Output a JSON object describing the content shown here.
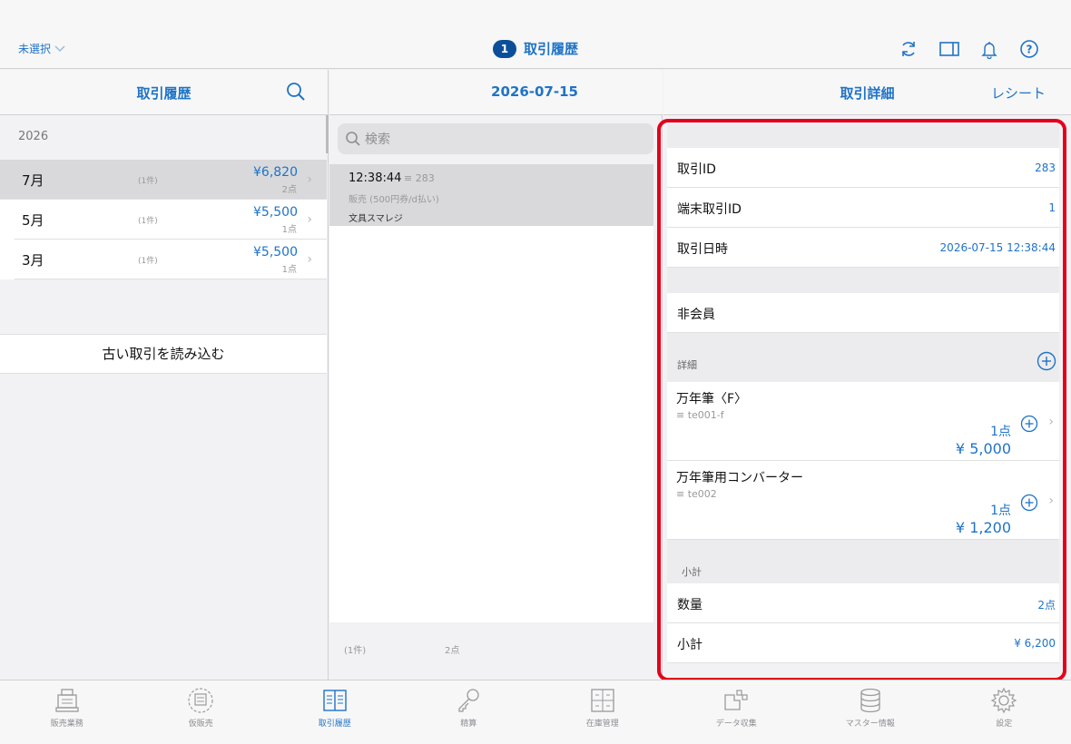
{
  "top_bar": {
    "store_selector": "未選択",
    "badge_count": "1",
    "title": "取引履歴",
    "icons": [
      "refresh-icon",
      "split-view-icon",
      "bell-icon",
      "help-icon"
    ]
  },
  "left_panel": {
    "title": "取引履歴",
    "year": "2026",
    "months": [
      {
        "name": "7月",
        "count": "(1件)",
        "amount": "¥6,820",
        "points": "2点",
        "selected": true
      },
      {
        "name": "5月",
        "count": "(1件)",
        "amount": "¥5,500",
        "points": "1点",
        "selected": false
      },
      {
        "name": "3月",
        "count": "(1件)",
        "amount": "¥5,500",
        "points": "1点",
        "selected": false
      }
    ],
    "load_older_label": "古い取引を読み込む"
  },
  "middle_panel": {
    "date": "2026-07-15",
    "search_placeholder": "検索",
    "transactions": [
      {
        "time": "12:38:44",
        "id": "283",
        "type": "販売 (500円券/d払い)",
        "store": "文具スマレジ"
      }
    ],
    "footer_count": "(1件)",
    "footer_points": "2点"
  },
  "right_panel": {
    "title": "取引詳細",
    "receipt_label": "レシート",
    "transaction_id_label": "取引ID",
    "transaction_id": "283",
    "terminal_tx_id_label": "端末取引ID",
    "terminal_tx_id": "1",
    "datetime_label": "取引日時",
    "datetime": "2026-07-15 12:38:44",
    "member": "非会員",
    "details_label": "詳細",
    "items": [
      {
        "name": "万年筆〈F〉",
        "code": "te001-f",
        "qty": "1点",
        "price": "¥ 5,000"
      },
      {
        "name": "万年筆用コンバーター",
        "code": "te002",
        "qty": "1点",
        "price": "¥ 1,200"
      }
    ],
    "subtotal_section_label": "小計",
    "quantity_label": "数量",
    "quantity": "2点",
    "subtotal_label": "小計",
    "subtotal": "¥ 6,200"
  },
  "tabbar": {
    "tabs": [
      {
        "label": "販売業務",
        "icon": "register-icon"
      },
      {
        "label": "仮販売",
        "icon": "temp-sale-icon"
      },
      {
        "label": "取引履歴",
        "icon": "ledger-icon",
        "active": true
      },
      {
        "label": "精算",
        "icon": "key-icon"
      },
      {
        "label": "在庫管理",
        "icon": "inventory-icon"
      },
      {
        "label": "データ収集",
        "icon": "data-collection-icon"
      },
      {
        "label": "マスター情報",
        "icon": "database-icon"
      },
      {
        "label": "設定",
        "icon": "gear-icon"
      }
    ]
  },
  "colors": {
    "accent": "#1f73c7",
    "badge": "#0b4f9a",
    "highlight": "#e3001b"
  }
}
